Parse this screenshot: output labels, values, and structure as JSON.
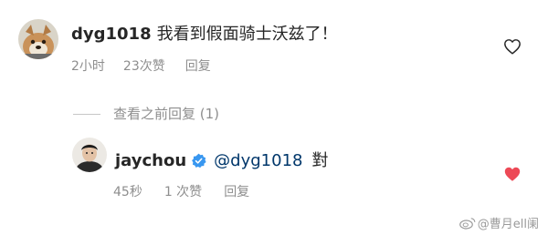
{
  "comments": [
    {
      "username": "dyg1018",
      "text": "我看到假面骑士沃兹了！",
      "time": "2小时",
      "likes": "23次赞",
      "reply_label": "回复",
      "liked": false
    }
  ],
  "replies_toggle": {
    "label": "查看之前回复 (1)"
  },
  "reply": {
    "username": "jaychou",
    "verified": true,
    "mention": "@dyg1018",
    "text": "對",
    "time": "45秒",
    "likes": "1 次赞",
    "reply_label": "回复",
    "liked": true
  },
  "watermark": {
    "text": "@曹月ell阑"
  },
  "colors": {
    "heart_liked": "#ed4956",
    "heart_outline": "#262626",
    "verified_badge": "#3897f0",
    "mention": "#00376b",
    "meta": "#8e8e8e"
  }
}
